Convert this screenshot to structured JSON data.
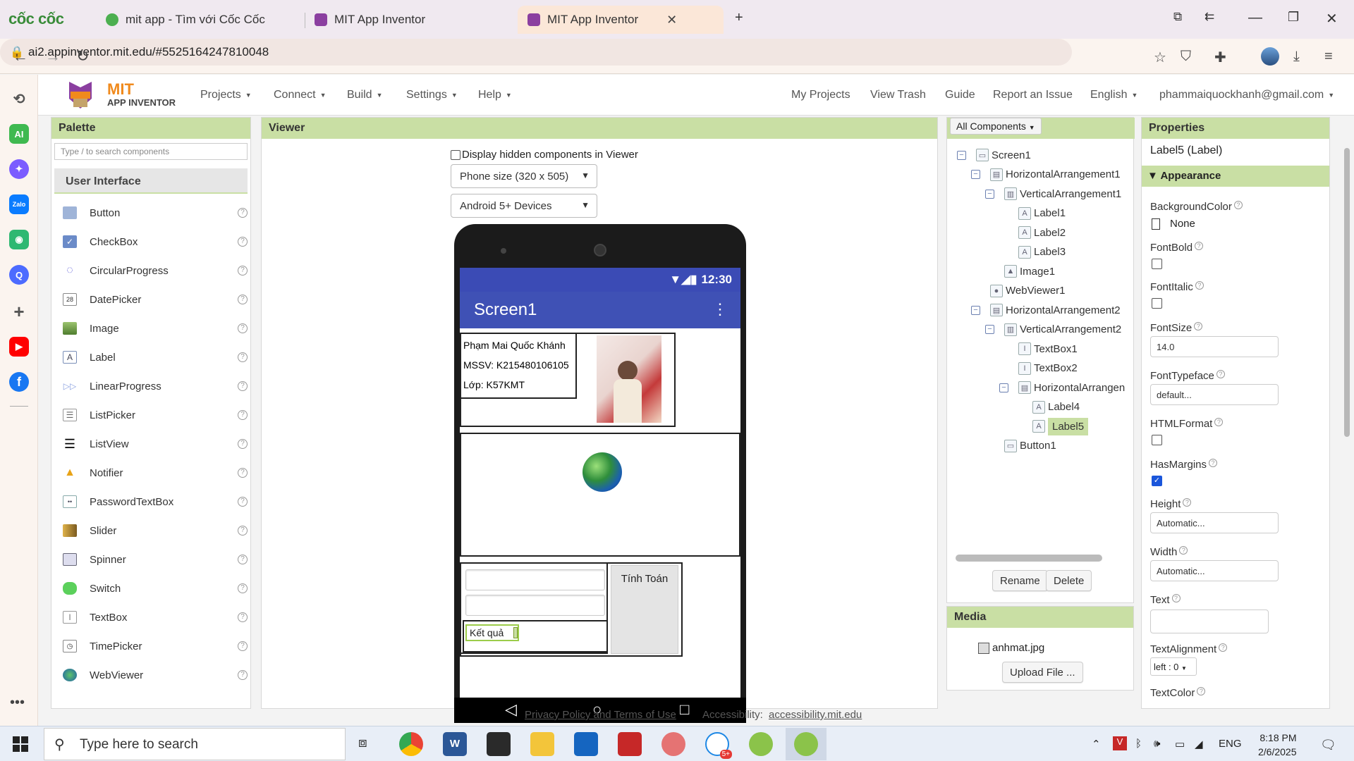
{
  "browser": {
    "brand": "cốc cốc",
    "tabs": [
      {
        "title": "mit app - Tìm với Cốc Cốc",
        "active": false
      },
      {
        "title": "MIT App Inventor",
        "active": false
      },
      {
        "title": "MIT App Inventor",
        "active": true
      }
    ],
    "url": "ai2.appinventor.mit.edu/#5525164247810048"
  },
  "sidebar_icons": [
    {
      "name": "history-icon",
      "color": "#555555",
      "glyph": "⟲"
    },
    {
      "name": "ai-icon",
      "color": "#3fb950",
      "glyph": "AI"
    },
    {
      "name": "messenger-icon",
      "color": "#7b5cff",
      "glyph": "✦"
    },
    {
      "name": "zalo-icon",
      "color": "#0a7cff",
      "glyph": "Zalo"
    },
    {
      "name": "game-icon",
      "color": "#2eb872",
      "glyph": "◉"
    },
    {
      "name": "q-icon",
      "color": "#4c6bff",
      "glyph": "Q"
    },
    {
      "name": "add-icon",
      "color": "#555555",
      "glyph": "+"
    },
    {
      "name": "youtube-icon",
      "color": "#ff0000",
      "glyph": "▶"
    },
    {
      "name": "facebook-icon",
      "color": "#1877f2",
      "glyph": "f"
    }
  ],
  "app": {
    "logo_line1": "MIT",
    "logo_line2": "APP INVENTOR",
    "menus": [
      "Projects",
      "Connect",
      "Build",
      "Settings",
      "Help"
    ],
    "right_links": [
      "My Projects",
      "View Trash",
      "Guide",
      "Report an Issue",
      "English"
    ],
    "user": "phammaiquockhanh@gmail.com",
    "accent_color": "#c9dfa4"
  },
  "palette": {
    "title": "Palette",
    "search_placeholder": "Type / to search components",
    "category": "User Interface",
    "items": [
      "Button",
      "CheckBox",
      "CircularProgress",
      "DatePicker",
      "Image",
      "Label",
      "LinearProgress",
      "ListPicker",
      "ListView",
      "Notifier",
      "PasswordTextBox",
      "Slider",
      "Spinner",
      "Switch",
      "TextBox",
      "TimePicker",
      "WebViewer"
    ],
    "help": "?"
  },
  "viewer": {
    "title": "Viewer",
    "hidden_components_label": "Display hidden components in Viewer",
    "size_select": "Phone size (320 x 505)",
    "device_select": "Android 5+ Devices",
    "phone": {
      "time": "12:30",
      "screen_title": "Screen1",
      "label1": "Phạm Mai Quốc Khánh",
      "label2": "MSSV: K215480106105",
      "label3": "Lớp: K57KMT",
      "button1": "Tính Toán",
      "label4": "Kết quả"
    }
  },
  "components": {
    "header": "All Components",
    "tree": [
      {
        "label": "Screen1",
        "depth": 0,
        "toggle": "⊟",
        "icon": "▭"
      },
      {
        "label": "HorizontalArrangement1",
        "depth": 1,
        "toggle": "⊟",
        "icon": "▤"
      },
      {
        "label": "VerticalArrangement1",
        "depth": 2,
        "toggle": "⊟",
        "icon": "▥"
      },
      {
        "label": "Label1",
        "depth": 3,
        "toggle": "",
        "icon": "A"
      },
      {
        "label": "Label2",
        "depth": 3,
        "toggle": "",
        "icon": "A"
      },
      {
        "label": "Label3",
        "depth": 3,
        "toggle": "",
        "icon": "A"
      },
      {
        "label": "Image1",
        "depth": 2,
        "toggle": "",
        "icon": "▲"
      },
      {
        "label": "WebViewer1",
        "depth": 1,
        "toggle": "",
        "icon": "●"
      },
      {
        "label": "HorizontalArrangement2",
        "depth": 1,
        "toggle": "⊟",
        "icon": "▤"
      },
      {
        "label": "VerticalArrangement2",
        "depth": 2,
        "toggle": "⊟",
        "icon": "▥"
      },
      {
        "label": "TextBox1",
        "depth": 3,
        "toggle": "",
        "icon": "I"
      },
      {
        "label": "TextBox2",
        "depth": 3,
        "toggle": "",
        "icon": "I"
      },
      {
        "label": "HorizontalArrangen",
        "depth": 3,
        "toggle": "⊟",
        "icon": "▤"
      },
      {
        "label": "Label4",
        "depth": 4,
        "toggle": "",
        "icon": "A"
      },
      {
        "label": "Label5",
        "depth": 4,
        "toggle": "",
        "icon": "A",
        "selected": true
      },
      {
        "label": "Button1",
        "depth": 2,
        "toggle": "",
        "icon": "▭"
      }
    ],
    "rename": "Rename",
    "delete": "Delete"
  },
  "media": {
    "title": "Media",
    "file": "anhmat.jpg",
    "upload": "Upload File ..."
  },
  "properties": {
    "title": "Properties",
    "component": "Label5 (Label)",
    "section": "Appearance",
    "background_color_label": "BackgroundColor",
    "background_color_value": "None",
    "font_bold_label": "FontBold",
    "font_italic_label": "FontItalic",
    "font_size_label": "FontSize",
    "font_size_value": "14.0",
    "font_typeface_label": "FontTypeface",
    "font_typeface_value": "default...",
    "html_format_label": "HTMLFormat",
    "has_margins_label": "HasMargins",
    "height_label": "Height",
    "height_value": "Automatic...",
    "width_label": "Width",
    "width_value": "Automatic...",
    "text_label": "Text",
    "text_alignment_label": "TextAlignment",
    "text_alignment_value": "left : 0",
    "text_color_label": "TextColor"
  },
  "footer": {
    "privacy": "Privacy Policy and Terms of Use",
    "accessibility_label": "Accessibility:",
    "accessibility_link": "accessibility.mit.edu"
  },
  "taskbar": {
    "search_placeholder": "Type here to search",
    "language": "ENG",
    "time": "8:18 PM",
    "date": "2/6/2025",
    "badge": "5+"
  }
}
